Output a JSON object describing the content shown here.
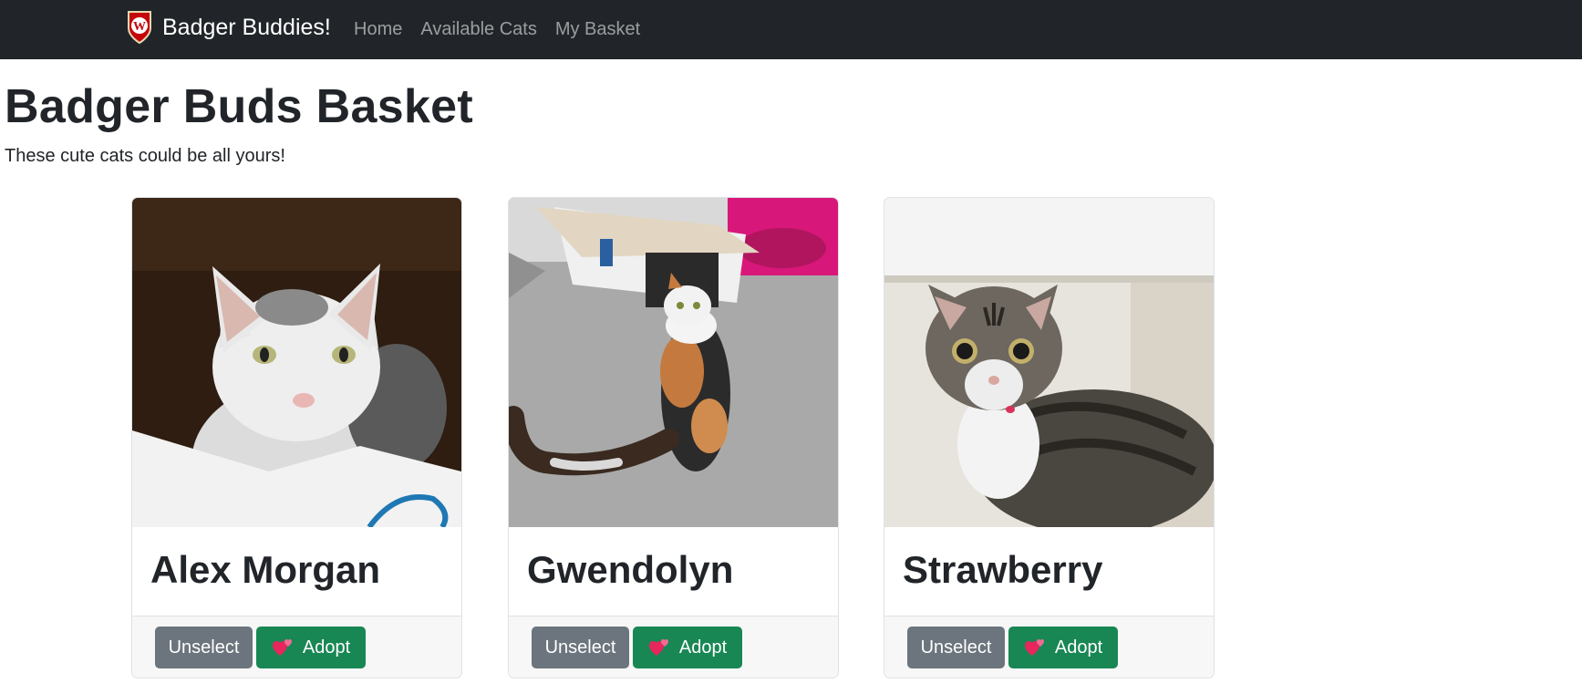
{
  "navbar": {
    "brand": "Badger Buddies!",
    "links": [
      "Home",
      "Available Cats",
      "My Basket"
    ]
  },
  "main": {
    "title": "Badger Buds Basket",
    "subtitle": "These cute cats could be all yours!"
  },
  "cats": [
    {
      "name": "Alex Morgan",
      "unselect_label": "Unselect",
      "adopt_label": "Adopt"
    },
    {
      "name": "Gwendolyn",
      "unselect_label": "Unselect",
      "adopt_label": "Adopt"
    },
    {
      "name": "Strawberry",
      "unselect_label": "Unselect",
      "adopt_label": "Adopt"
    }
  ],
  "colors": {
    "navbar_bg": "#212529",
    "unselect_button": "#6c757d",
    "adopt_button": "#198754",
    "heart": "#e8265e"
  },
  "icons": {
    "brand": "uw-crest-logo",
    "adopt": "two-hearts-icon"
  }
}
